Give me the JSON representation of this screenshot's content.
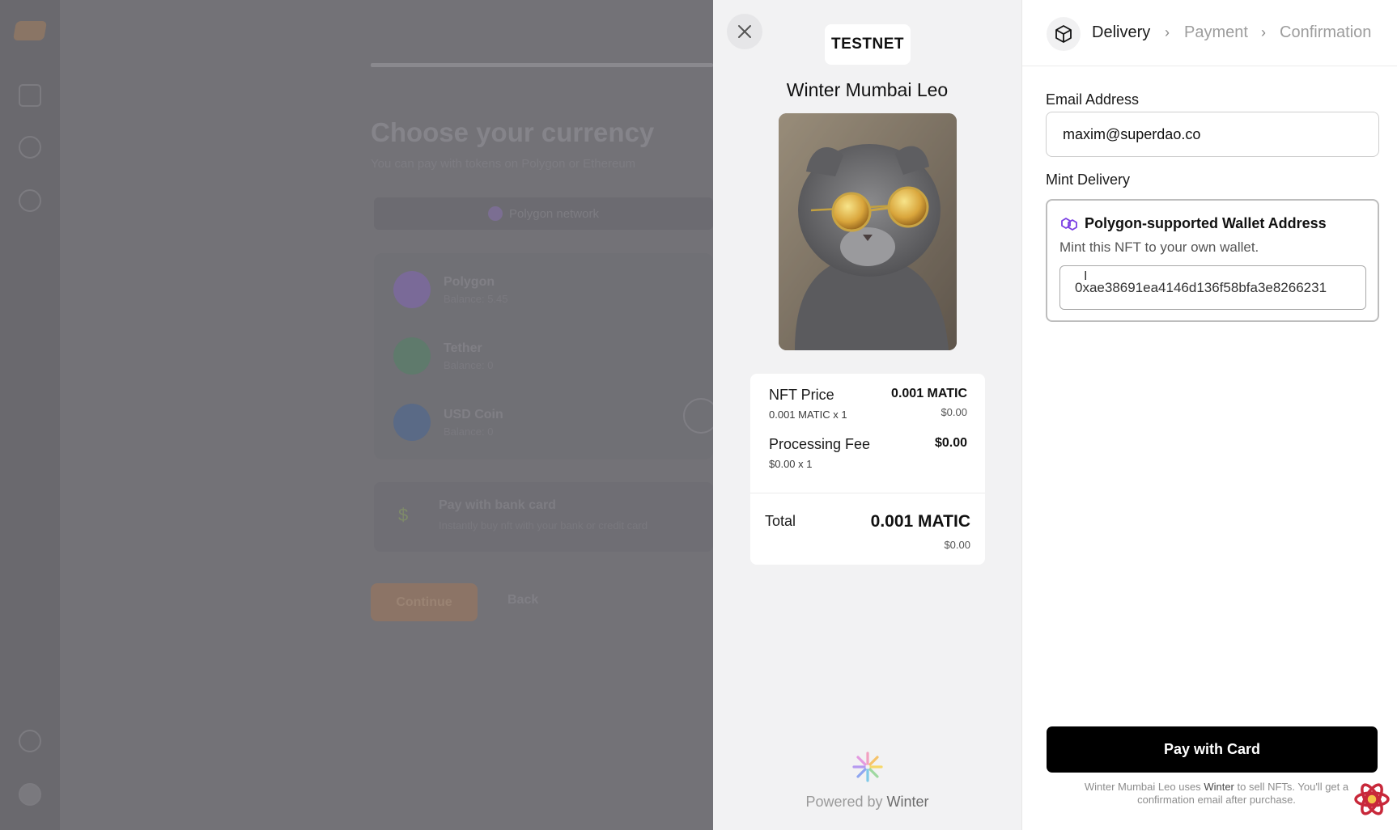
{
  "background_app": {
    "title": "Choose your currency",
    "subtitle": "You can pay with tokens on Polygon or Ethereum",
    "network_tab": "Polygon network",
    "currencies": [
      {
        "name": "Polygon",
        "balance": "Balance: 5.45",
        "color": "#7a6a98"
      },
      {
        "name": "Tether",
        "balance": "Balance: 0",
        "color": "#5f7a6c"
      },
      {
        "name": "USD Coin",
        "balance": "Balance: 0",
        "color": "#5a6a86"
      }
    ],
    "bank_card": {
      "symbol": "$",
      "title": "Pay with bank card",
      "description": "Instantly buy nft with your bank or credit card"
    },
    "continue_label": "Continue",
    "back_label": "Back"
  },
  "summary": {
    "close_icon": "close-icon",
    "network_badge": "TESTNET",
    "nft_name": "Winter Mumbai Leo",
    "nft_image": "gray-cat-with-sunglasses",
    "price_rows": [
      {
        "label": "NFT Price",
        "sub": "0.001 MATIC x 1",
        "value": "0.001 MATIC",
        "usd": "$0.00"
      },
      {
        "label": "Processing Fee",
        "sub": "$0.00 x 1",
        "value": "$0.00",
        "usd": ""
      }
    ],
    "total": {
      "label": "Total",
      "value": "0.001 MATIC",
      "usd": "$0.00"
    },
    "powered_by_prefix": "Powered by",
    "powered_by_brand": "Winter"
  },
  "checkout": {
    "steps": [
      {
        "label": "Delivery",
        "active": true
      },
      {
        "label": "Payment",
        "active": false
      },
      {
        "label": "Confirmation",
        "active": false
      }
    ],
    "step_separator": "›",
    "email": {
      "label": "Email Address",
      "value": "maxim@superdao.co"
    },
    "mint_delivery": {
      "label": "Mint Delivery",
      "option_title": "Polygon-supported Wallet Address",
      "option_description": "Mint this NFT to your own wallet.",
      "wallet_value": "0xae38691ea4146d136f58bfa3e8266231"
    },
    "pay_button": "Pay with Card",
    "footer": {
      "nft_name": "Winter Mumbai Leo",
      "uses": "uses",
      "brand": "Winter",
      "rest": "to sell NFTs. You'll get a confirmation email after purchase."
    }
  },
  "colors": {
    "accent_black": "#000000",
    "polygon_purple": "#7b3fe4",
    "overlay_gray": "#737277"
  }
}
